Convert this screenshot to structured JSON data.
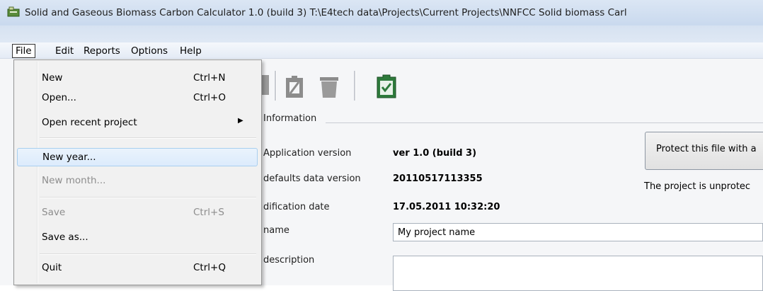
{
  "window": {
    "title": "Solid and Gaseous Biomass Carbon Calculator 1.0 (build 3) T:\\E4tech data\\Projects\\Current Projects\\NNFCC Solid biomass Carl"
  },
  "menubar": {
    "file": "File",
    "edit": "Edit",
    "reports": "Reports",
    "options": "Options",
    "help": "Help"
  },
  "file_menu": {
    "items": [
      {
        "label": "New",
        "shortcut": "Ctrl+N",
        "enabled": true
      },
      {
        "label": "Open...",
        "shortcut": "Ctrl+O",
        "enabled": true
      },
      {
        "label": "Open recent project",
        "shortcut": "",
        "submenu": true,
        "enabled": true
      },
      {
        "label": "New year...",
        "shortcut": "",
        "enabled": true,
        "highlighted": true
      },
      {
        "label": "New month...",
        "shortcut": "",
        "enabled": false
      },
      {
        "label": "Save",
        "shortcut": "Ctrl+S",
        "enabled": false
      },
      {
        "label": "Save as...",
        "shortcut": "",
        "enabled": true
      },
      {
        "label": "Quit",
        "shortcut": "Ctrl+Q",
        "enabled": true
      }
    ]
  },
  "info_panel": {
    "group_title": "Information",
    "rows": [
      {
        "label": "Application version",
        "value": "ver 1.0 (build 3)"
      },
      {
        "label": "defaults data version",
        "value": "20110517113355"
      },
      {
        "label": "dification date",
        "value": "17.05.2011 10:32:20"
      },
      {
        "label": "name",
        "value": "My project name"
      },
      {
        "label": "description",
        "value": ""
      }
    ],
    "protect_button": "Protect this file with a",
    "status": "The project is unprotec"
  }
}
